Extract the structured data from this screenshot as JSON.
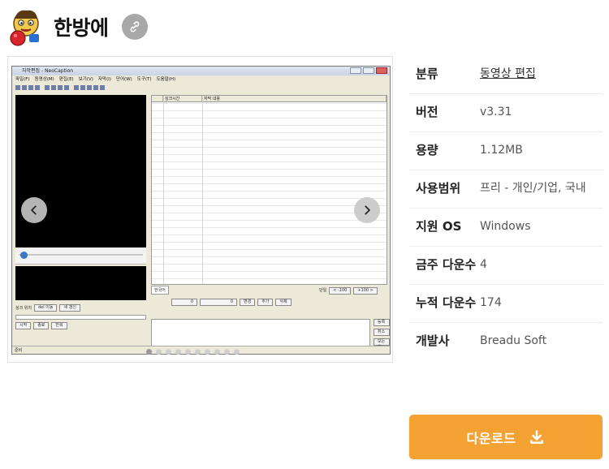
{
  "app": {
    "title": "한방에"
  },
  "screenshot": {
    "window_title": "자막편집 - NeoCaption",
    "menu": [
      "파일(F)",
      "동영상(M)",
      "편집(E)",
      "보기(V)",
      "자막(I)",
      "단어(W)",
      "도구(T)",
      "도움말(H)"
    ],
    "grid_headers": [
      "",
      "싱크시간",
      "자막 내용"
    ],
    "tab_label": "한국어",
    "checkbox_label": "단일",
    "nav_buttons": [
      "< -100",
      "+100 >"
    ],
    "time_buttons": [
      "0",
      "0",
      "변경",
      "추가",
      "삭제"
    ],
    "left_label": "싱크 위치",
    "left_buttons": [
      "del 이동",
      "새 갱신",
      "시작",
      "종료",
      "반복"
    ],
    "side_buttons": [
      "등록",
      "취소",
      "모든행"
    ],
    "status_text": "준비",
    "slide_count": 10,
    "active_slide": 0
  },
  "info": {
    "rows": [
      {
        "label": "분류",
        "value": "동영상 편집",
        "link": true
      },
      {
        "label": "버전",
        "value": "v3.31"
      },
      {
        "label": "용량",
        "value": "1.12MB"
      },
      {
        "label": "사용범위",
        "value": "프리 - 개인/기업, 국내"
      },
      {
        "label": "지원 OS",
        "value": "Windows"
      },
      {
        "label": "금주 다운수",
        "value": "4"
      },
      {
        "label": "누적 다운수",
        "value": "174"
      },
      {
        "label": "개발사",
        "value": "Breadu Soft"
      }
    ]
  },
  "download": {
    "label": "다운로드"
  },
  "colors": {
    "accent": "#f4a233",
    "share_button": "#a8a8a8"
  }
}
